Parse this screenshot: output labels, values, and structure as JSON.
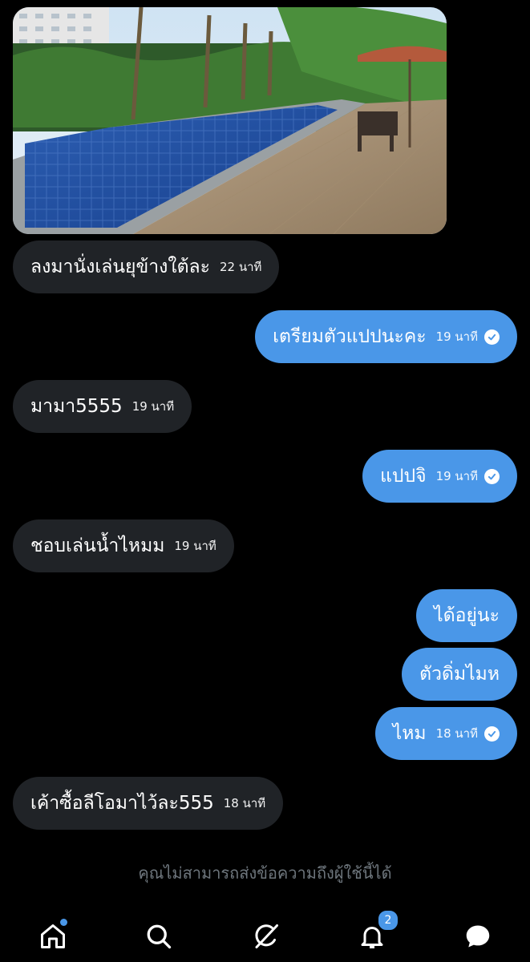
{
  "chat": {
    "photo_alt": "pool photo",
    "messages": [
      {
        "dir": "in",
        "text": "ลงมานั่งเล่นยุข้างใต้ละ",
        "time": "22 นาที"
      },
      {
        "dir": "out",
        "text": "เตรียมตัวแปปนะคะ",
        "time": "19 นาที",
        "read": true
      },
      {
        "dir": "in",
        "text": "มามา5555",
        "time": "19 นาที"
      },
      {
        "dir": "out",
        "text": "แปปจิ",
        "time": "19 นาที",
        "read": true
      },
      {
        "dir": "in",
        "text": "ชอบเล่นน้ำไหมม",
        "time": "19 นาที"
      },
      {
        "dir": "out",
        "text": "ได้อยู่นะ",
        "time": ""
      },
      {
        "dir": "out",
        "text": "ตัวดิ่มไมห",
        "time": ""
      },
      {
        "dir": "out",
        "text": "ไหม",
        "time": "18 นาที",
        "read": true
      },
      {
        "dir": "in",
        "text": "เค้าซื้อลีโอมาไว้ละ555",
        "time": "18 นาที"
      }
    ],
    "notice": "คุณไม่สามารถส่งข้อความถึงผู้ใช้นี้ได้"
  },
  "nav": {
    "items": [
      "home-icon",
      "search-icon",
      "grok-icon",
      "bell-icon",
      "messages-icon"
    ],
    "notification_count": "2",
    "accent": "#4a97e8"
  }
}
